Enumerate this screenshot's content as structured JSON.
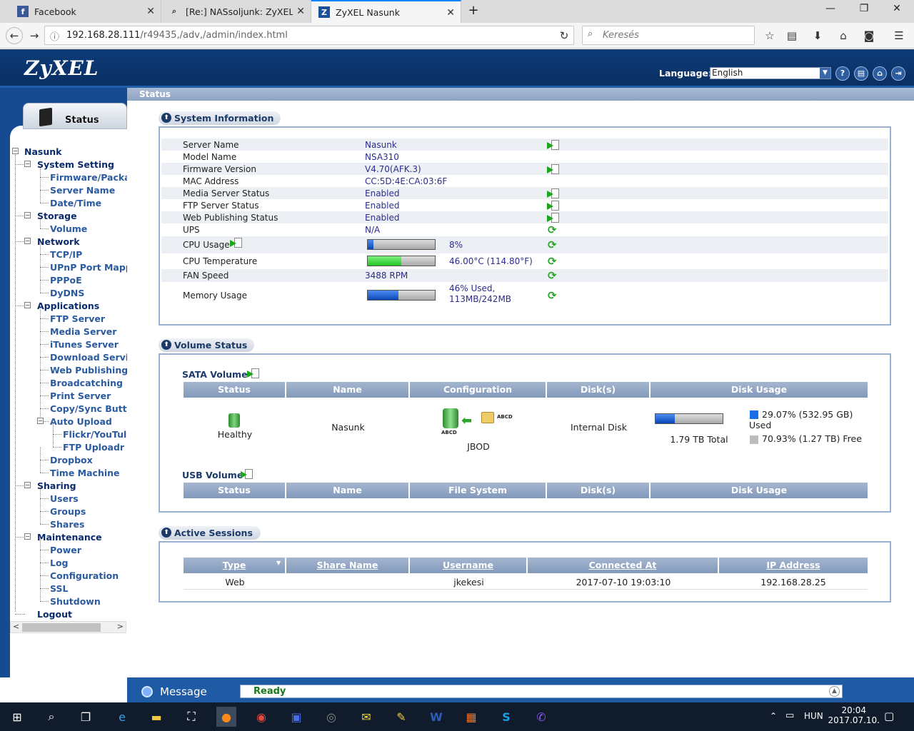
{
  "browser": {
    "tabs": [
      {
        "label": "Facebook",
        "icon": "facebook-icon"
      },
      {
        "label": "[Re:] NASsoljunk: ZyXEL NSA",
        "icon": "forum-icon"
      },
      {
        "label": "ZyXEL Nasunk",
        "icon": "zyxel-icon"
      }
    ],
    "url_host": "192.168.28.111",
    "url_path": "/r49435,/adv,/admin/index.html",
    "search_placeholder": "Keresés"
  },
  "header": {
    "logo": "ZyXEL",
    "language_label": "Language:",
    "language_value": "English"
  },
  "sidebar": {
    "tab_label": "Status",
    "root": "Nasunk",
    "items": [
      {
        "label": "System Setting",
        "level": 1,
        "exp": "−"
      },
      {
        "label": "Firmware/Packa",
        "level": 2
      },
      {
        "label": "Server Name",
        "level": 2
      },
      {
        "label": "Date/Time",
        "level": 2
      },
      {
        "label": "Storage",
        "level": 1,
        "exp": "−"
      },
      {
        "label": "Volume",
        "level": 2
      },
      {
        "label": "Network",
        "level": 1,
        "exp": "−"
      },
      {
        "label": "TCP/IP",
        "level": 2
      },
      {
        "label": "UPnP Port Mappi",
        "level": 2
      },
      {
        "label": "PPPoE",
        "level": 2
      },
      {
        "label": "DyDNS",
        "level": 2
      },
      {
        "label": "Applications",
        "level": 1,
        "exp": "−"
      },
      {
        "label": "FTP Server",
        "level": 2
      },
      {
        "label": "Media Server",
        "level": 2
      },
      {
        "label": "iTunes Server",
        "level": 2
      },
      {
        "label": "Download Servic",
        "level": 2
      },
      {
        "label": "Web Publishing",
        "level": 2
      },
      {
        "label": "Broadcatching",
        "level": 2
      },
      {
        "label": "Print Server",
        "level": 2
      },
      {
        "label": "Copy/Sync Butto",
        "level": 2
      },
      {
        "label": "Auto Upload",
        "level": 2,
        "exp": "−"
      },
      {
        "label": "Flickr/YouTul",
        "level": 3
      },
      {
        "label": "FTP Uploadr",
        "level": 3
      },
      {
        "label": "Dropbox",
        "level": 2
      },
      {
        "label": "Time Machine",
        "level": 2
      },
      {
        "label": "Sharing",
        "level": 1,
        "exp": "−"
      },
      {
        "label": "Users",
        "level": 2
      },
      {
        "label": "Groups",
        "level": 2
      },
      {
        "label": "Shares",
        "level": 2
      },
      {
        "label": "Maintenance",
        "level": 1,
        "exp": "−"
      },
      {
        "label": "Power",
        "level": 2
      },
      {
        "label": "Log",
        "level": 2
      },
      {
        "label": "Configuration",
        "level": 2
      },
      {
        "label": "SSL",
        "level": 2
      },
      {
        "label": "Shutdown",
        "level": 2
      },
      {
        "label": "Logout",
        "level": 1
      }
    ]
  },
  "breadcrumb": "Status",
  "system_info": {
    "title": "System Information",
    "rows": [
      {
        "k": "Server Name",
        "v": "Nasunk"
      },
      {
        "k": "Model Name",
        "v": "NSA310"
      },
      {
        "k": "Firmware Version",
        "v": "V4.70(AFK.3)"
      },
      {
        "k": "MAC Address",
        "v": "CC:5D:4E:CA:03:6F"
      },
      {
        "k": "Media Server Status",
        "v": "Enabled"
      },
      {
        "k": "FTP Server Status",
        "v": "Enabled"
      },
      {
        "k": "Web Publishing Status",
        "v": "Enabled"
      },
      {
        "k": "UPS",
        "v": "N/A"
      },
      {
        "k": "CPU Usage",
        "v": "8%"
      },
      {
        "k": "CPU Temperature",
        "v": "46.00°C (114.80°F)"
      },
      {
        "k": "FAN Speed",
        "v": "3488 RPM"
      },
      {
        "k": "Memory Usage",
        "v": "46% Used,",
        "v2": "113MB/242MB"
      }
    ],
    "cpu_usage_fraction": 0.08,
    "cpu_temp_fraction": 0.5,
    "memory_fraction": 0.46
  },
  "volume_status": {
    "title": "Volume Status",
    "sata_title": "SATA Volume",
    "usb_title": "USB Volume",
    "columns": [
      "Status",
      "Name",
      "Configuration",
      "Disk(s)",
      "Disk Usage"
    ],
    "usb_columns": [
      "Status",
      "Name",
      "File System",
      "Disk(s)",
      "Disk Usage"
    ],
    "sata_row": {
      "status": "Healthy",
      "name": "Nasunk",
      "config": "JBOD",
      "config_label": "ABCD",
      "disks": "Internal Disk",
      "total": "1.79 TB Total",
      "used": "29.07% (532.95 GB)",
      "used_word": "Used",
      "free": "70.93% (1.27 TB) Free",
      "used_fraction": 0.2907
    }
  },
  "sessions": {
    "title": "Active Sessions",
    "columns": [
      "Type",
      "Share Name",
      "Username",
      "Connected At",
      "IP Address"
    ],
    "rows": [
      {
        "type": "Web",
        "share": "",
        "user": "jkekesi",
        "at": "2017-07-10 19:03:10",
        "ip": "192.168.28.25"
      }
    ]
  },
  "message_bar": {
    "label": "Message",
    "status": "Ready"
  },
  "taskbar": {
    "lang": "HUN",
    "time": "20:04",
    "date": "2017.07.10."
  }
}
